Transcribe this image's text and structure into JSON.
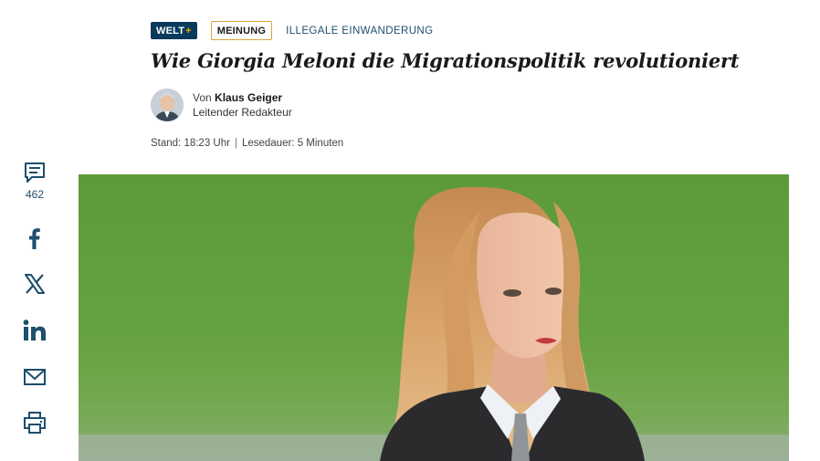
{
  "brand": {
    "welt": "WELT",
    "plus": "+"
  },
  "category": "MEINUNG",
  "topic": "ILLEGALE EINWANDERUNG",
  "headline": "Wie Giorgia Meloni die Migrationspolitik revolutioniert",
  "author": {
    "prefix": "Von",
    "name": "Klaus Geiger",
    "role": "Leitender Redakteur"
  },
  "meta": {
    "stand": "Stand: 18:23 Uhr",
    "separator": "|",
    "lesedauer": "Lesedauer: 5 Minuten"
  },
  "share": {
    "comments_count": "462",
    "icons": [
      "comment-icon",
      "facebook-icon",
      "x-icon",
      "linkedin-icon",
      "mail-icon",
      "print-icon"
    ]
  },
  "colors": {
    "brand_navy": "#0a3a5c",
    "plus_gold": "#f2a900",
    "meinung_border": "#d9a441",
    "link_blue": "#1d4f6e"
  }
}
